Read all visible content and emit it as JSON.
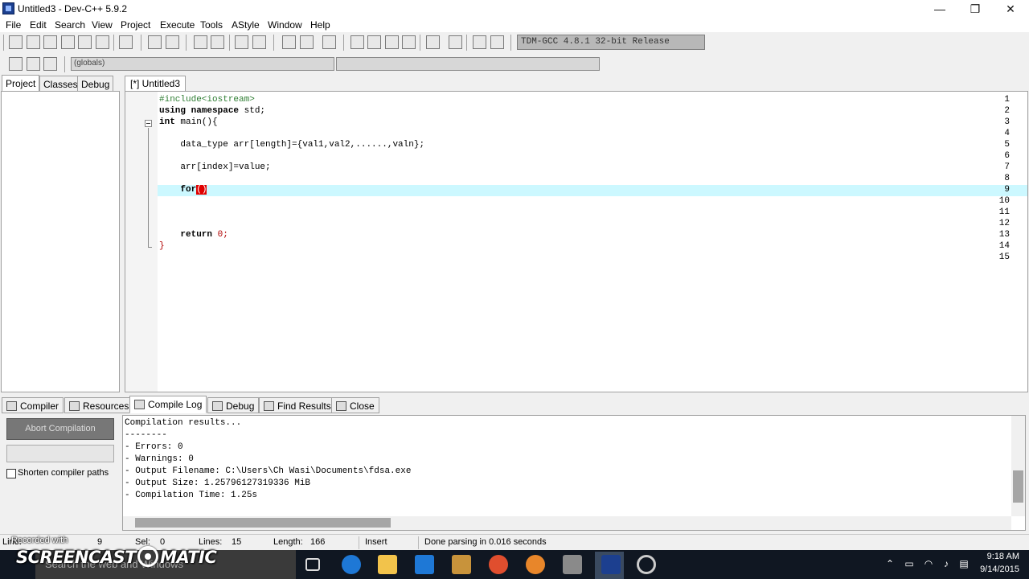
{
  "window": {
    "title": "Untitled3 - Dev-C++ 5.9.2",
    "minimize_glyph": "—",
    "maximize_glyph": "❐",
    "close_glyph": "✕"
  },
  "menu": [
    "File",
    "Edit",
    "Search",
    "View",
    "Project",
    "Execute",
    "Tools",
    "AStyle",
    "Window",
    "Help"
  ],
  "toolbar": {
    "compiler_select": "TDM-GCC 4.8.1 32-bit Release",
    "globals_select": "(globals)"
  },
  "left_tabs": [
    "Project",
    "Classes",
    "Debug"
  ],
  "editor": {
    "tab_label": "[*] Untitled3",
    "line_numbers": [
      "1",
      "2",
      "3",
      "4",
      "5",
      "6",
      "7",
      "8",
      "9",
      "10",
      "11",
      "12",
      "13",
      "14",
      "15"
    ],
    "lines": {
      "l1": "#include<iostream>",
      "l2a": "using namespace",
      "l2b": " std;",
      "l3a": "int",
      "l3b": " main(){",
      "l5": "    data_type arr[length]={val1,val2,......,valn};",
      "l7": "    arr[index]=value;",
      "l9a": "    for",
      "l9b": "(",
      "l9c": ")",
      "l13a": "    return",
      "l13b": " 0;",
      "l14": "}"
    }
  },
  "bottom_tabs": [
    "Compiler",
    "Resources",
    "Compile Log",
    "Debug",
    "Find Results",
    "Close"
  ],
  "compile": {
    "abort_label": "Abort Compilation",
    "shorten_label": "Shorten compiler paths",
    "shorten_checked": false,
    "log": [
      "Compilation results...",
      "--------",
      "- Errors: 0",
      "- Warnings: 0",
      "- Output Filename: C:\\Users\\Ch Wasi\\Documents\\fdsa.exe",
      "- Output Size: 1.25796127319336 MiB",
      "- Compilation Time: 1.25s"
    ]
  },
  "status": {
    "line_label": "Line:",
    "line_value": "9",
    "sel_label": "Sel:",
    "sel_value": "0",
    "lines_label": "Lines:",
    "lines_value": "15",
    "length_label": "Length:",
    "length_value": "166",
    "mode": "Insert",
    "message": "Done parsing in 0.016 seconds"
  },
  "overlay": {
    "recorded_with": "Recorded with",
    "brand_left": "SCREENCAST",
    "brand_right": "MATIC"
  },
  "taskbar": {
    "search_placeholder": "Search the web and Windows",
    "time": "9:18 AM",
    "date": "9/14/2015"
  },
  "colors": {
    "active_line": "#ccf8ff",
    "bracket_highlight": "#e00000",
    "string_red": "#b00000",
    "taskbar": "#101722"
  }
}
